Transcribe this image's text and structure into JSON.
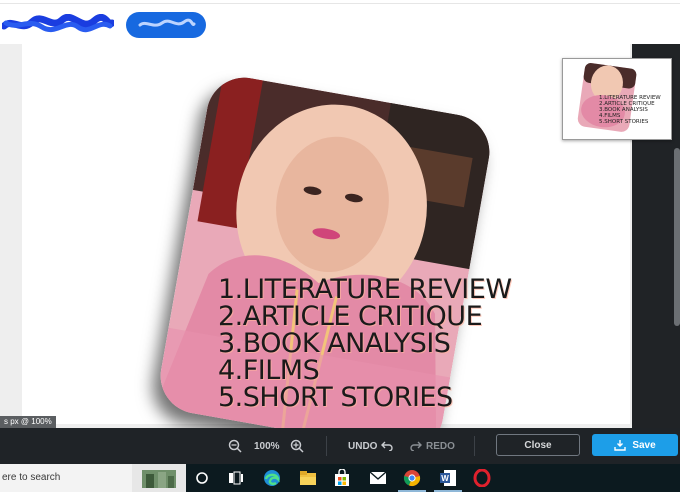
{
  "editor": {
    "list_items": [
      "1.LITERATURE REVIEW",
      "2.ARTICLE CRITIQUE",
      "3.BOOK ANALYSIS",
      "4.FILMS",
      "5.SHORT STORIES"
    ],
    "size_label": "s px @ 100%"
  },
  "toolbar": {
    "zoom_level": "100%",
    "undo_label": "UNDO",
    "redo_label": "REDO",
    "close_label": "Close",
    "save_label": "Save"
  },
  "taskbar": {
    "search_text": "ere to search",
    "apps": [
      "start-circle",
      "task-view",
      "edge",
      "file-explorer",
      "store",
      "mail",
      "chrome",
      "word",
      "opera"
    ]
  },
  "colors": {
    "accent": "#1d9ee8",
    "toolbar_bg": "#1f2327",
    "taskbar_bg": "#0c1a1f",
    "redacted_blue": "#1769e0"
  }
}
